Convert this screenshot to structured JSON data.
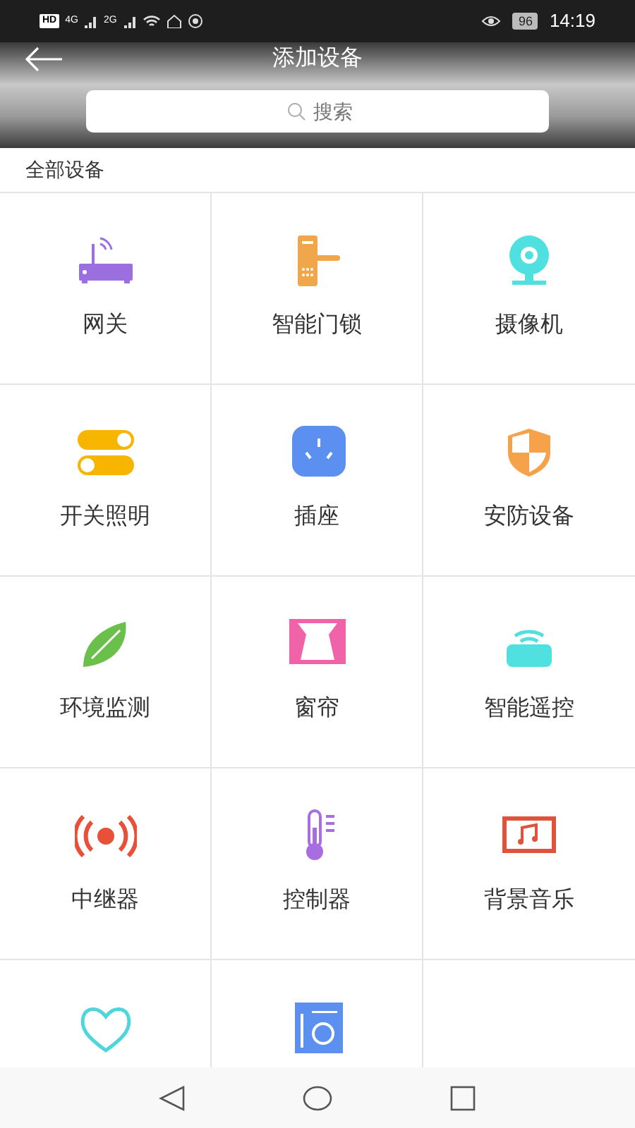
{
  "status_bar": {
    "hd": "HD",
    "network_1": "4G",
    "network_2": "2G",
    "battery": "96",
    "time": "14:19"
  },
  "header": {
    "title": "添加设备"
  },
  "search": {
    "placeholder": "搜索"
  },
  "section": {
    "title": "全部设备"
  },
  "devices": [
    {
      "kind": "router",
      "label": "网关"
    },
    {
      "kind": "lock",
      "label": "智能门锁"
    },
    {
      "kind": "camera",
      "label": "摄像机"
    },
    {
      "kind": "switch",
      "label": "开关照明"
    },
    {
      "kind": "socket",
      "label": "插座"
    },
    {
      "kind": "shield",
      "label": "安防设备"
    },
    {
      "kind": "leaf",
      "label": "环境监测"
    },
    {
      "kind": "curtain",
      "label": "窗帘"
    },
    {
      "kind": "remote",
      "label": "智能遥控"
    },
    {
      "kind": "repeater",
      "label": "中继器"
    },
    {
      "kind": "thermometer",
      "label": "控制器"
    },
    {
      "kind": "music",
      "label": "背景音乐"
    },
    {
      "kind": "heart"
    },
    {
      "kind": "washer"
    }
  ]
}
